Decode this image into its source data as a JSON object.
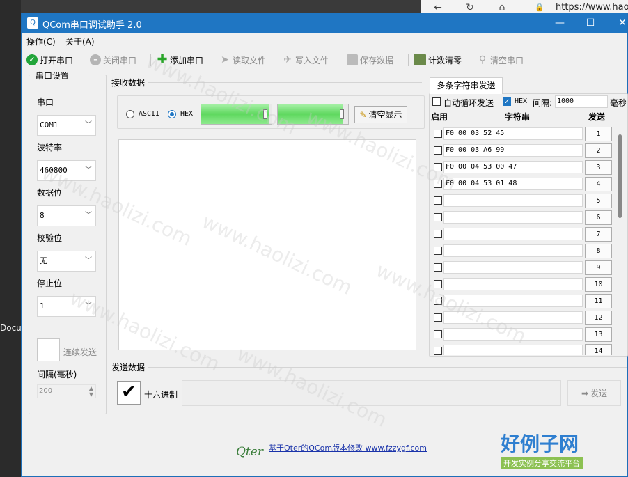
{
  "browser": {
    "url": "https://www.haol"
  },
  "taskbar_left": "Docu",
  "window": {
    "title": "QCom串口调试助手 2.0",
    "icon": "Q"
  },
  "window_controls": {
    "minimize": "—",
    "maximize": "☐",
    "close": "✕"
  },
  "menu": [
    "操作(C)",
    "关于(A)"
  ],
  "toolbar": {
    "open": "打开串口",
    "close": "关闭串口",
    "add": "添加串口",
    "read": "读取文件",
    "write": "写入文件",
    "save": "保存数据",
    "reset_count": "计数清零",
    "clear": "清空串口"
  },
  "settings": {
    "title": "串口设置",
    "port_label": "串口",
    "port_value": "COM1",
    "baud_label": "波特率",
    "baud_value": "460800",
    "data_bits_label": "数据位",
    "data_bits_value": "8",
    "parity_label": "校验位",
    "parity_value": "无",
    "stop_label": "停止位",
    "stop_value": "1",
    "continuous_label": "连续发送",
    "interval_label": "间隔(毫秒)",
    "interval_value": "200"
  },
  "receive": {
    "title": "接收数据",
    "ascii": "ASCII",
    "hex": "HEX",
    "clear_btn": "清空显示",
    "progress1": 0.97,
    "progress2": 0.93
  },
  "multi": {
    "tab": "多条字符串发送",
    "auto_loop": "自动循环发送",
    "hex": "HEX",
    "interval_label": "间隔:",
    "interval_value": "1000",
    "ms": "毫秒",
    "col_enable": "启用",
    "col_string": "字符串",
    "col_send": "发送",
    "rows": [
      {
        "text": "F0 00 03 52 45",
        "num": "1"
      },
      {
        "text": "F0 00 03 A6 99",
        "num": "2"
      },
      {
        "text": "F0 00 04 53 00 47",
        "num": "3"
      },
      {
        "text": "F0 00 04 53 01 48",
        "num": "4"
      },
      {
        "text": "",
        "num": "5"
      },
      {
        "text": "",
        "num": "6"
      },
      {
        "text": "",
        "num": "7"
      },
      {
        "text": "",
        "num": "8"
      },
      {
        "text": "",
        "num": "9"
      },
      {
        "text": "",
        "num": "10"
      },
      {
        "text": "",
        "num": "11"
      },
      {
        "text": "",
        "num": "12"
      },
      {
        "text": "",
        "num": "13"
      },
      {
        "text": "",
        "num": "14"
      }
    ]
  },
  "send": {
    "title": "发送数据",
    "hex_label": "十六进制",
    "send_btn": "发送",
    "check_mark": "✔"
  },
  "footer": {
    "logo": "Qter",
    "link": "基于Qter的QCom版本修改 www.fzzygf.com"
  },
  "watermark": {
    "text": "www.haolizi.com",
    "brand": "好例子网",
    "brand_sub": "开发实例分享交流平台"
  }
}
